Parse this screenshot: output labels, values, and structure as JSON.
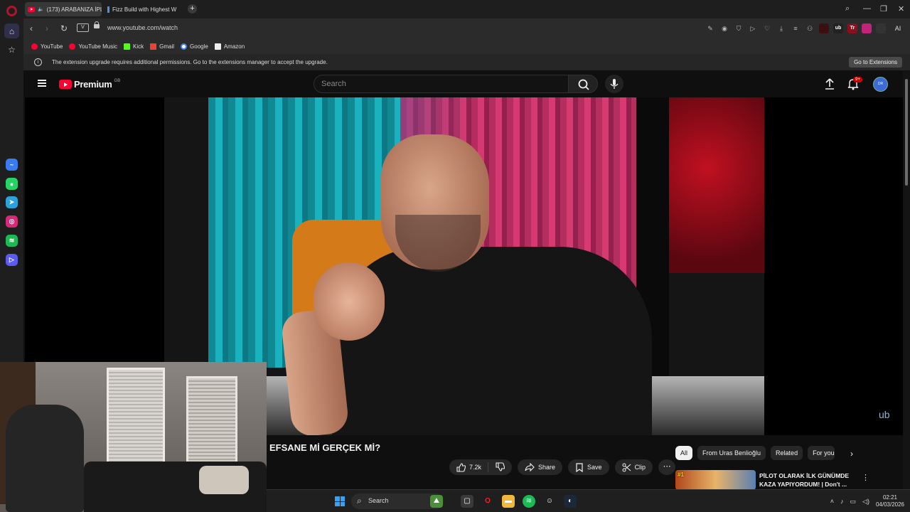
{
  "browser": {
    "tabs": [
      {
        "title": "(173) ARABANIZA İPL",
        "active": true
      },
      {
        "title": "Fizz Build with Highest W",
        "active": false
      }
    ],
    "new_tab_label": "+",
    "url": "www.youtube.com/watch",
    "vpn_label": "V",
    "ai_label": "AI",
    "bookmarks": [
      "YouTube",
      "YouTube Music",
      "Kick",
      "Gmail",
      "Google",
      "Amazon"
    ],
    "infobar": {
      "message": "The extension upgrade requires additional permissions. Go to the extensions manager to accept the upgrade.",
      "button": "Go to Extensions"
    },
    "extension_badges": [
      "",
      "ub",
      "Tr",
      "",
      ""
    ]
  },
  "youtube": {
    "logo_text": "Premium",
    "logo_country": "GB",
    "search_placeholder": "Search",
    "notification_count": "9+",
    "avatar_text": "DR",
    "video": {
      "title": "EFSANE Mİ GERÇEK Mİ?",
      "likes": "7.2k",
      "share_label": "Share",
      "save_label": "Save",
      "clip_label": "Clip",
      "watermark": "ub"
    },
    "chips": [
      "All",
      "From Uras Benlioğlu",
      "Related",
      "For you"
    ],
    "recommendation": {
      "rank": "#1",
      "title": "PİLOT OLARAK İLK GÜNÜMDE KAZA YAPIYORDUM! | Don't ..."
    }
  },
  "taskbar": {
    "search_label": "Search",
    "time": "02:21",
    "date": "04/03/2026"
  }
}
